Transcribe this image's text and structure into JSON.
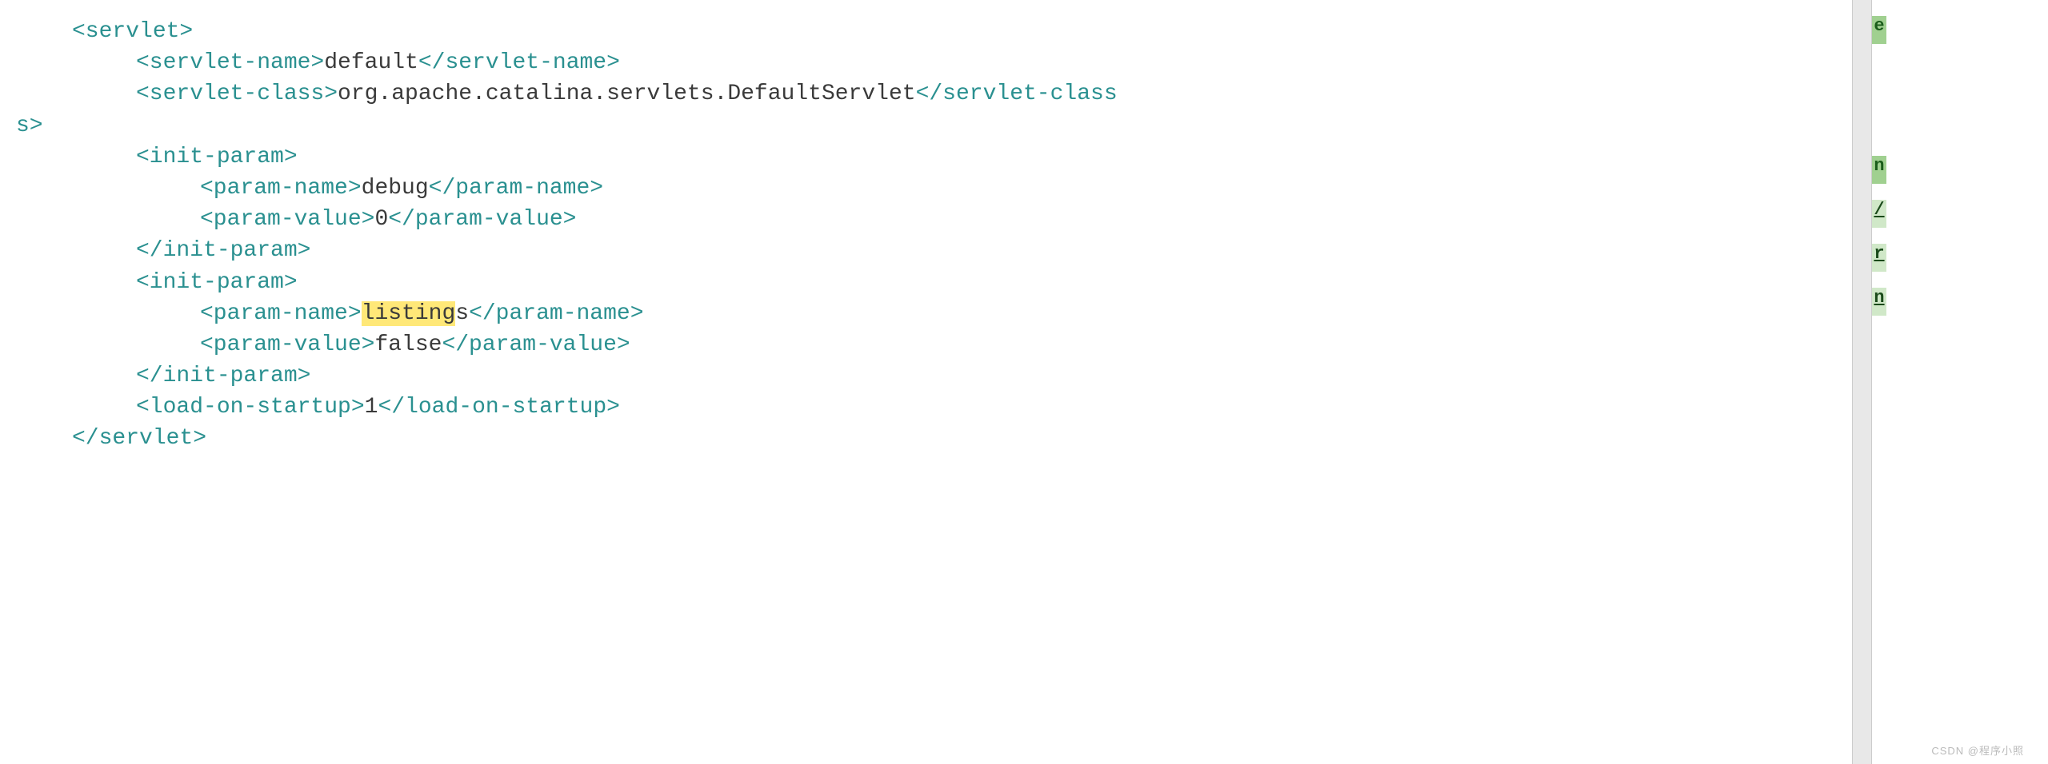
{
  "xml": {
    "servlet_open": "<servlet>",
    "servlet_close": "</servlet>",
    "servlet_name_open": "<servlet-name>",
    "servlet_name_close": "</servlet-name>",
    "servlet_name_value": "default",
    "servlet_class_open": "<servlet-class>",
    "servlet_class_close": "</servlet-class",
    "servlet_class_close2": "s>",
    "servlet_class_value": "org.apache.catalina.servlets.DefaultServlet",
    "init_param_open": "<init-param>",
    "init_param_close": "</init-param>",
    "param_name_open": "<param-name>",
    "param_name_close": "</param-name>",
    "param_value_open": "<param-value>",
    "param_value_close": "</param-value>",
    "param1_name": "debug",
    "param1_value": "0",
    "param2_name_highlight": "listing",
    "param2_name_rest": "s",
    "param2_value": "false",
    "load_on_startup_open": "<load-on-startup>",
    "load_on_startup_close": "</load-on-startup>",
    "load_on_startup_value": "1"
  },
  "gutter": {
    "cell1": "e",
    "cell2": "n",
    "cell3": "/",
    "cell4": "r",
    "cell5": "n"
  },
  "watermark": "CSDN @程序小照"
}
